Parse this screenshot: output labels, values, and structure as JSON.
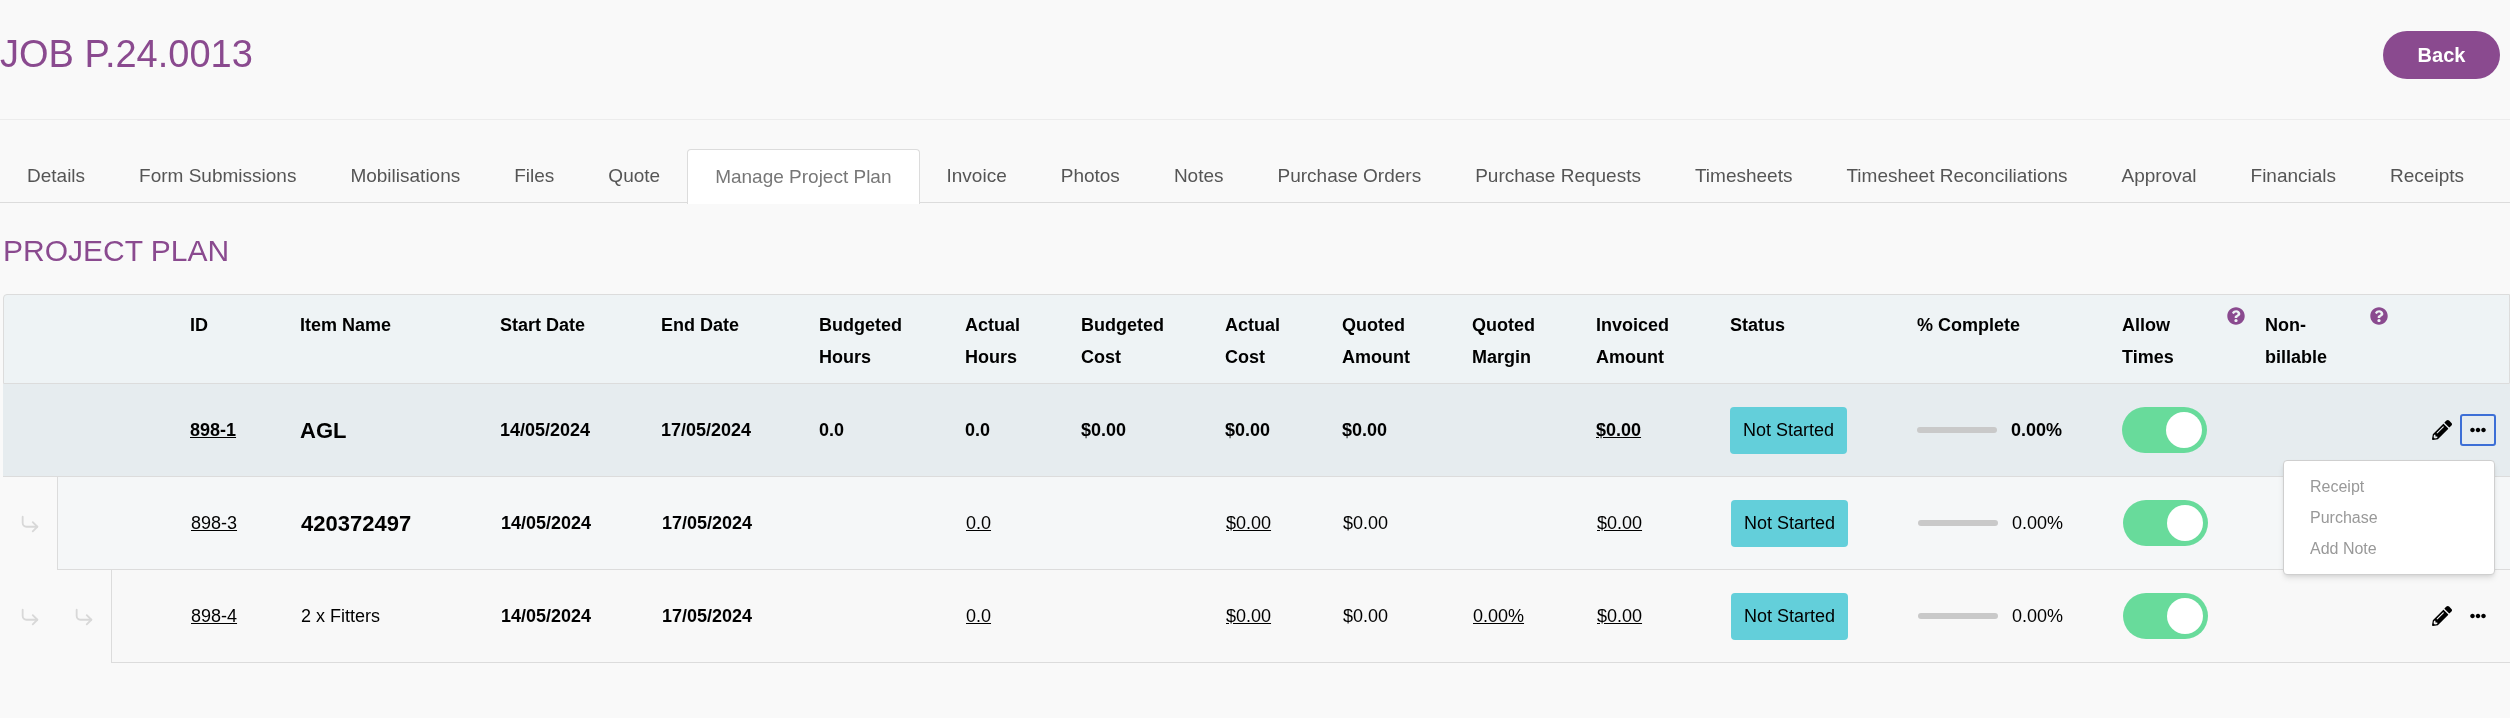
{
  "title": "JOB P.24.0013",
  "back_button": "Back",
  "tabs": [
    {
      "label": "Details",
      "selected": false
    },
    {
      "label": "Form Submissions",
      "selected": false
    },
    {
      "label": "Mobilisations",
      "selected": false
    },
    {
      "label": "Files",
      "selected": false
    },
    {
      "label": "Quote",
      "selected": false
    },
    {
      "label": "Manage Project Plan",
      "selected": true
    },
    {
      "label": "Invoice",
      "selected": false
    },
    {
      "label": "Photos",
      "selected": false
    },
    {
      "label": "Notes",
      "selected": false
    },
    {
      "label": "Purchase Orders",
      "selected": false
    },
    {
      "label": "Purchase Requests",
      "selected": false
    },
    {
      "label": "Timesheets",
      "selected": false
    },
    {
      "label": "Timesheet Reconciliations",
      "selected": false
    },
    {
      "label": "Approval",
      "selected": false
    },
    {
      "label": "Financials",
      "selected": false
    },
    {
      "label": "Receipts",
      "selected": false
    }
  ],
  "section_title": "PROJECT PLAN",
  "table": {
    "columns": [
      {
        "label": "ID",
        "help": false
      },
      {
        "label": "Item Name",
        "help": false
      },
      {
        "label": "Start Date",
        "help": false
      },
      {
        "label": "End Date",
        "help": false
      },
      {
        "label": "Budgeted Hours",
        "help": false
      },
      {
        "label": "Actual Hours",
        "help": false
      },
      {
        "label": "Budgeted Cost",
        "help": false
      },
      {
        "label": "Actual Cost",
        "help": false
      },
      {
        "label": "Quoted Amount",
        "help": false
      },
      {
        "label": "Quoted Margin",
        "help": false
      },
      {
        "label": "Invoiced Amount",
        "help": false
      },
      {
        "label": "Status",
        "help": false
      },
      {
        "label": "% Complete",
        "help": false
      },
      {
        "label": "Allow Times",
        "help": true
      },
      {
        "label": "Non-billable",
        "help": true
      }
    ],
    "rows": [
      {
        "cells": [
          {
            "text": "898-1",
            "link": true
          },
          {
            "text": "AGL",
            "link": false
          },
          {
            "text": "14/05/2024",
            "link": false
          },
          {
            "text": "17/05/2024",
            "link": false
          },
          {
            "text": "0.0",
            "link": false
          },
          {
            "text": "0.0",
            "link": false
          },
          {
            "text": "$0.00",
            "link": false
          },
          {
            "text": "$0.00",
            "link": false
          },
          {
            "text": "$0.00",
            "link": false
          },
          null,
          {
            "text": "$0.00",
            "link": true
          }
        ],
        "status": "Not Started",
        "level": 0,
        "reading": "0.00%",
        "allow_times": true,
        "menu_open": true,
        "children": [
          {
            "cells": [
              {
                "text": "898-3",
                "link": true
              },
              {
                "text": "420372497",
                "link": false
              },
              {
                "text": "14/05/2024",
                "link": false
              },
              {
                "text": "17/05/2024",
                "link": false
              },
              null,
              {
                "text": "0.0",
                "link": true
              },
              null,
              {
                "text": "$0.00",
                "link": true
              },
              {
                "text": "$0.00",
                "link": false
              },
              null,
              {
                "text": "$0.00",
                "link": true
              }
            ],
            "status": "Not Started",
            "level": 0,
            "reading": "0.00%",
            "allow_times": true,
            "children": [
              {
                "cells": [
                  {
                    "text": "898-4",
                    "link": true
                  },
                  {
                    "text": "2 x Fitters",
                    "link": false
                  },
                  {
                    "text": "14/05/2024",
                    "link": false
                  },
                  {
                    "text": "17/05/2024",
                    "link": false
                  },
                  null,
                  {
                    "text": "0.0",
                    "link": true
                  },
                  null,
                  {
                    "text": "$0.00",
                    "link": true
                  },
                  {
                    "text": "$0.00",
                    "link": false
                  },
                  {
                    "text": "0.00%",
                    "link": true
                  },
                  {
                    "text": "$0.00",
                    "link": true
                  }
                ],
                "status": "Not Started",
                "level": 0,
                "reading": "0.00%",
                "allow_times": true,
                "menu_open": false
              }
            ]
          }
        ]
      }
    ]
  },
  "row_menu": {
    "items": [
      "Receipt",
      "Purchase",
      "Add Note"
    ]
  }
}
